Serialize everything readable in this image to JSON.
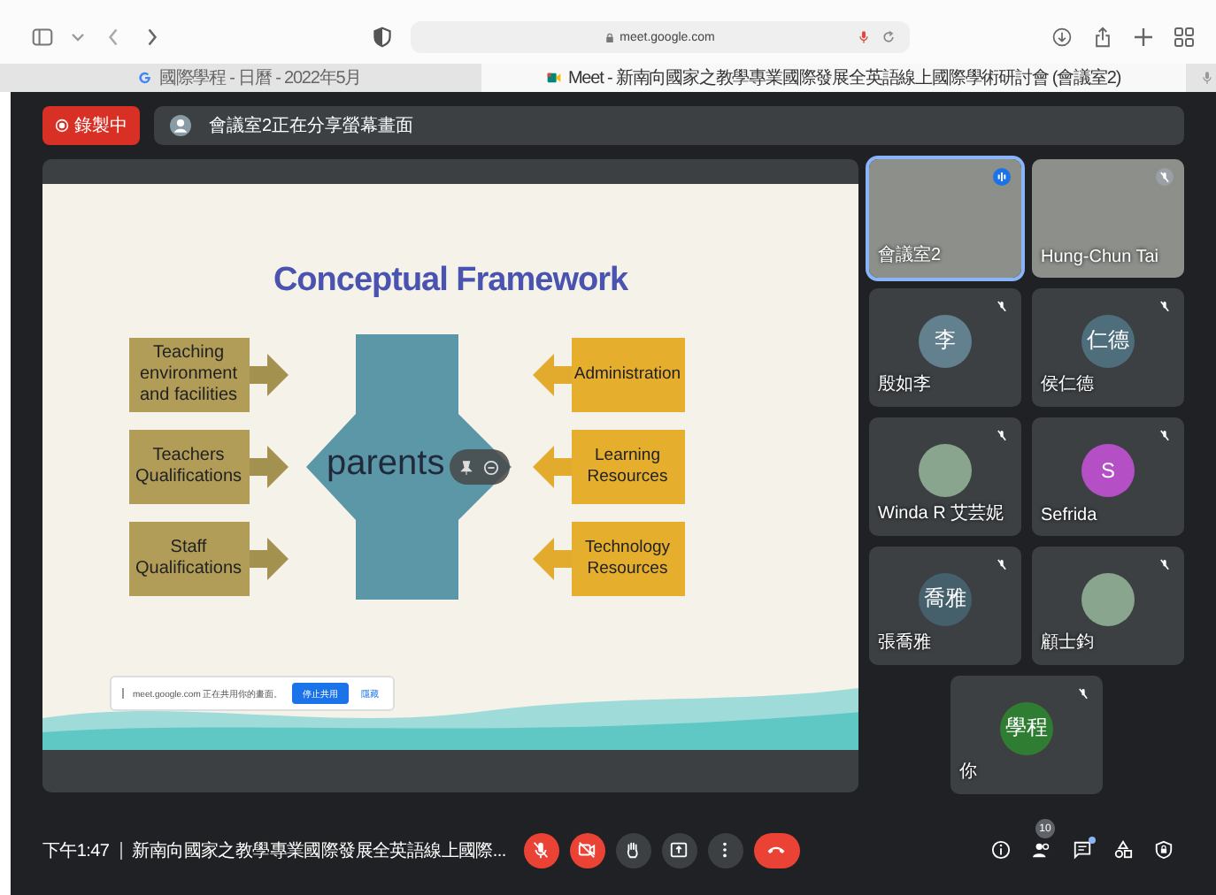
{
  "browser": {
    "url": "meet.google.com",
    "tabs": [
      {
        "title": "國際學程 - 日曆 - 2022年5月",
        "selected": false
      },
      {
        "title": "Meet - 新南向國家之教學專業國際發展全英語線上國際學術研討會 (會議室2)",
        "selected": true
      }
    ]
  },
  "recording": {
    "label": "錄製中"
  },
  "presenting_banner": {
    "text": "會議室2正在分享螢幕畫面"
  },
  "slide": {
    "title": "Conceptual Framework",
    "center": "parents",
    "left_items": [
      "Teaching environment and facilities",
      "Teachers Qualifications",
      "Staff Qualifications"
    ],
    "right_items": [
      "Administration",
      "Learning Resources",
      "Technology Resources"
    ]
  },
  "share_bar": {
    "text": "meet.google.com 正在共用你的畫面。",
    "stop_button": "停止共用",
    "hide_button": "隱藏"
  },
  "participants": [
    {
      "name": "會議室2",
      "kind": "video",
      "speaking": true
    },
    {
      "name": "Hung-Chun Tai",
      "kind": "video",
      "speaking": false
    },
    {
      "name": "殷如李",
      "kind": "initials",
      "initials": "李",
      "color": "#62808e",
      "speaking": false
    },
    {
      "name": "侯仁德",
      "kind": "initials",
      "initials": "仁德",
      "color": "#4f6e7c",
      "speaking": false
    },
    {
      "name": "Winda R 艾芸妮",
      "kind": "photo",
      "speaking": false
    },
    {
      "name": "Sefrida",
      "kind": "initials",
      "initials": "S",
      "color": "#b44fc6",
      "speaking": false
    },
    {
      "name": "張喬雅",
      "kind": "initials",
      "initials": "喬雅",
      "color": "#455f6b",
      "speaking": false
    },
    {
      "name": "顧士鈞",
      "kind": "photo",
      "speaking": false
    },
    {
      "name": "你",
      "kind": "initials",
      "initials": "學程",
      "color": "#2f7d32",
      "speaking": false
    }
  ],
  "bottom_bar": {
    "time": "下午1:47",
    "meeting_title": "新南向國家之教學專業國際發展全英語線上國際...",
    "mic_on": false,
    "camera_on": false,
    "people_count": "10",
    "chat_unread": true
  }
}
